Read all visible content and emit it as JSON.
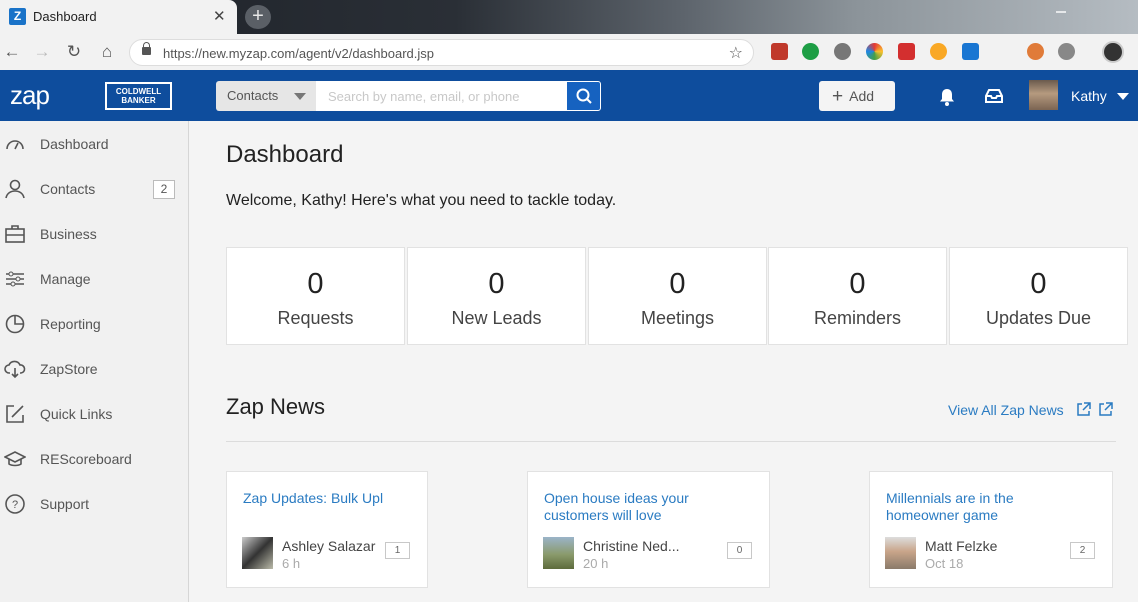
{
  "browser": {
    "tab_title": "Dashboard",
    "tab_favicon": "Z",
    "url": "https://new.myzap.com/agent/v2/dashboard.jsp"
  },
  "header": {
    "logo": "zap",
    "brand_logo": "COLDWELL BANKER",
    "search_scope": "Contacts",
    "search_placeholder": "Search by name, email, or phone",
    "add_label": "Add",
    "user_name": "Kathy"
  },
  "sidebar": {
    "items": [
      {
        "label": "Dashboard",
        "icon": "gauge-icon"
      },
      {
        "label": "Contacts",
        "icon": "person-icon",
        "badge": "2"
      },
      {
        "label": "Business",
        "icon": "briefcase-icon"
      },
      {
        "label": "Manage",
        "icon": "sliders-icon"
      },
      {
        "label": "Reporting",
        "icon": "pie-chart-icon"
      },
      {
        "label": "ZapStore",
        "icon": "cloud-download-icon"
      },
      {
        "label": "Quick Links",
        "icon": "external-edit-icon"
      },
      {
        "label": "REScoreboard",
        "icon": "graduation-cap-icon"
      },
      {
        "label": "Support",
        "icon": "help-icon"
      }
    ]
  },
  "main": {
    "title": "Dashboard",
    "welcome": "Welcome, Kathy! Here's what you need to tackle today.",
    "stats": [
      {
        "value": "0",
        "label": "Requests"
      },
      {
        "value": "0",
        "label": "New Leads"
      },
      {
        "value": "0",
        "label": "Meetings"
      },
      {
        "value": "0",
        "label": "Reminders"
      },
      {
        "value": "0",
        "label": "Updates Due"
      }
    ],
    "news_title": "Zap News",
    "view_all": "View All Zap News",
    "news": [
      {
        "title_line1": "Zap Updates: Bulk Upl",
        "title_line2": "",
        "author": "Ashley Salazar",
        "time": "6 h",
        "comments": "1"
      },
      {
        "title_line1": "Open house ideas your",
        "title_line2": "customers will love",
        "author": "Christine Ned...",
        "time": "20 h",
        "comments": "0"
      },
      {
        "title_line1": "Millennials are in the",
        "title_line2": "homeowner game",
        "author": "Matt Felzke",
        "time": "Oct 18",
        "comments": "2"
      }
    ]
  },
  "colors": {
    "header_blue": "#0e4d9d",
    "link_blue": "#2a7bc2",
    "search_button": "#1662c0"
  }
}
